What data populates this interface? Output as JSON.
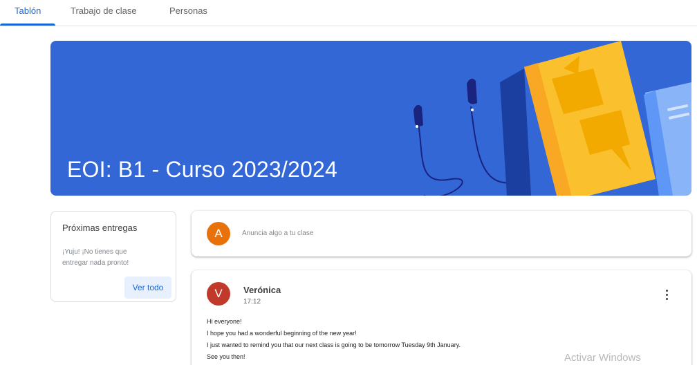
{
  "tabs": [
    {
      "label": "Tablón",
      "active": true
    },
    {
      "label": "Trabajo de clase",
      "active": false
    },
    {
      "label": "Personas",
      "active": false
    }
  ],
  "banner": {
    "title": "EOI: B1 - Curso 2023/2024",
    "background_color": "#3367d6"
  },
  "upcoming": {
    "title": "Próximas entregas",
    "message": "¡Yuju! ¡No tienes que entregar nada pronto!",
    "view_all_label": "Ver todo"
  },
  "announce": {
    "avatar_letter": "A",
    "avatar_color": "#e8710a",
    "placeholder": "Anuncia algo a tu clase"
  },
  "post": {
    "avatar_letter": "V",
    "avatar_color": "#c0392b",
    "author": "Verónica",
    "time": "17:12",
    "menu_icon": "more-vert-icon",
    "lines": [
      "Hi everyone!",
      "I hope you had a wonderful beginning of the new year!",
      "I just wanted to remind you that our next class is going to be tomorrow Tuesday 9th January.",
      "See you then!"
    ]
  },
  "watermark": "Activar Windows",
  "colors": {
    "accent": "#1967d2",
    "accent_light": "#e8f0fe"
  }
}
